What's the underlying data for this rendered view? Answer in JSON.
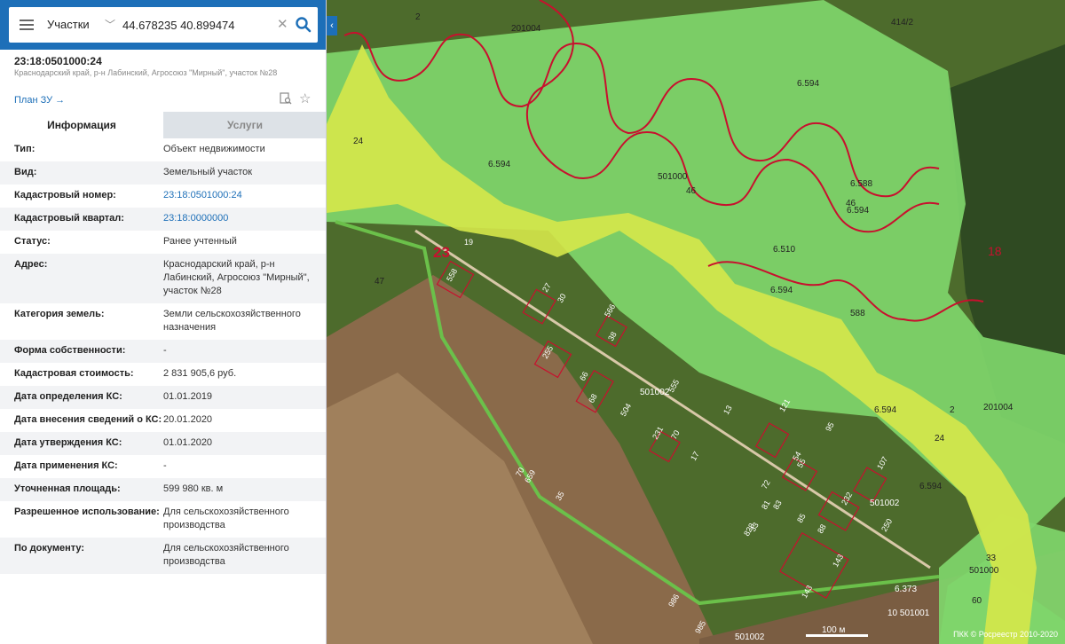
{
  "search": {
    "layer": "Участки",
    "value": "44.678235 40.899474"
  },
  "object": {
    "cad_number": "23:18:0501000:24",
    "address_line": "Краснодарский край, р-н Лабинский, Агросоюз \"Мирный\", участок №28",
    "plan_link": "План ЗУ →"
  },
  "tabs": {
    "info": "Информация",
    "services": "Услуги"
  },
  "info": [
    {
      "k": "Тип:",
      "v": "Объект недвижимости"
    },
    {
      "k": "Вид:",
      "v": "Земельный участок"
    },
    {
      "k": "Кадастровый номер:",
      "v": "23:18:0501000:24"
    },
    {
      "k": "Кадастровый квартал:",
      "v": "23:18:0000000"
    },
    {
      "k": "Статус:",
      "v": "Ранее учтенный"
    },
    {
      "k": "Адрес:",
      "v": "Краснодарский край, р-н Лабинский, Агросоюз \"Мирный\", участок №28"
    },
    {
      "k": "Категория земель:",
      "v": "Земли сельскохозяйственного назначения"
    },
    {
      "k": "Форма собственности:",
      "v": "-"
    },
    {
      "k": "Кадастровая стоимость:",
      "v": "2 831 905,6 руб."
    },
    {
      "k": "Дата определения КС:",
      "v": "01.01.2019"
    },
    {
      "k": "Дата внесения сведений о КС:",
      "v": "20.01.2020"
    },
    {
      "k": "Дата утверждения КС:",
      "v": "01.01.2020"
    },
    {
      "k": "Дата применения КС:",
      "v": "-"
    },
    {
      "k": "Уточненная площадь:",
      "v": "599 980 кв. м"
    },
    {
      "k": "Разрешенное использование:",
      "v": "Для сельскохозяйственного производства"
    },
    {
      "k": "По документу:",
      "v": "Для сельскохозяйственного производства"
    }
  ],
  "map": {
    "labels": {
      "l2a": "2",
      "l201004a": "201004",
      "l414": "414/2",
      "l6594a": "6.594",
      "l24a": "24",
      "l6594b": "6.594",
      "l501000": "501000",
      "l46": "46",
      "l6588a": "6.588",
      "l46b": "46",
      "l6594c": "6.594",
      "l18": "18",
      "l23": "23",
      "l19": "19",
      "l47": "47",
      "l6510": "6.510",
      "l6594d": "6.594",
      "l588b": "588",
      "l501002a": "501002",
      "l6594e": "6.594",
      "l2b": "2",
      "l201004b": "201004",
      "l24b": "24",
      "l6594f": "6.594",
      "l501002b": "501002",
      "l33": "33",
      "l501000b": "501000",
      "l60": "60",
      "l10501001": "10 501001",
      "l501002c": "501002",
      "l6373": "6.373"
    },
    "parcel_numbers": [
      "558",
      "27",
      "30",
      "566",
      "38",
      "255",
      "66",
      "68",
      "504",
      "555",
      "231",
      "70",
      "17",
      "121",
      "95",
      "54",
      "55",
      "72",
      "81",
      "83",
      "85",
      "88",
      "232",
      "107",
      "143",
      "250",
      "828",
      "33",
      "143",
      "659",
      "70",
      "35",
      "986",
      "985",
      "13"
    ],
    "scale": "100 м",
    "copyright": "ПКК © Росреестр 2010-2020"
  },
  "colors": {
    "header": "#1d6fb8",
    "link": "#1d6fb8",
    "zone_green": "#7fd66b",
    "zone_yellow": "#d6e84a",
    "boundary": "#c8102e"
  }
}
